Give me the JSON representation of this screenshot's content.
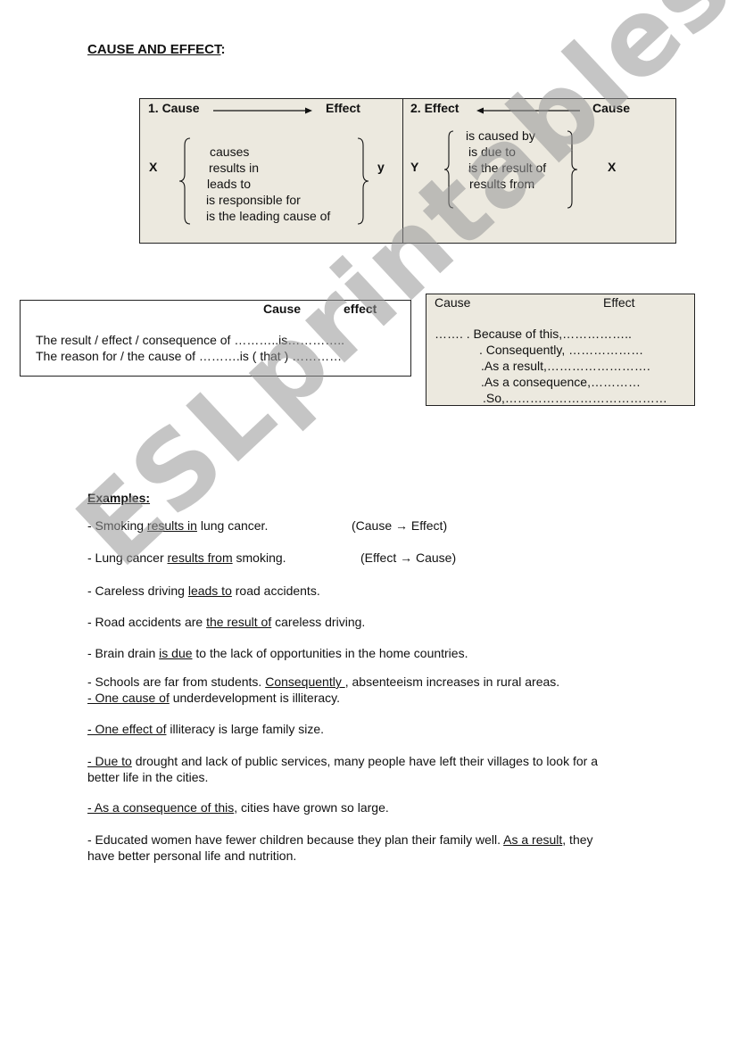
{
  "title": "CAUSE AND EFFECT",
  "title_colon": ":",
  "diagram1": {
    "header_left": "1. Cause",
    "header_right": "Effect",
    "left_var": "X",
    "right_var": "y",
    "phrases": [
      "causes",
      "results in",
      "leads to",
      "is responsible for",
      "is the leading cause of"
    ]
  },
  "diagram2": {
    "header_left": "2. Effect",
    "header_right": "Cause",
    "left_var": "Y",
    "right_var": "X",
    "phrases": [
      "is caused by",
      "is due to",
      "is the result of",
      "results from"
    ]
  },
  "noun_box": {
    "col_cause": "Cause",
    "col_effect": "effect",
    "lines": [
      "The result / effect / consequence of ………..is…………..",
      "The reason for  /  the cause of  ……….is ( that ) …………"
    ]
  },
  "connector_box": {
    "col_cause": "Cause",
    "col_effect": "Effect",
    "lines": [
      "…….  . Because of this,……………..",
      ". Consequently, ………………",
      ".As a result,…………………….",
      ".As a consequence,…………",
      ".So,…………………………………"
    ]
  },
  "examples": {
    "heading": "Examples:",
    "items": [
      {
        "pre": "- Smoking ",
        "u": "results in",
        "post": " lung cancer.",
        "note": "(Cause → Effect)"
      },
      {
        "pre": "- Lung cancer ",
        "u": "results from",
        "post": " smoking.",
        "note": "(Effect → Cause)"
      },
      {
        "pre": "- Careless driving ",
        "u": "leads to",
        "post": " road accidents."
      },
      {
        "pre": "- Road accidents are ",
        "u": "the result of",
        "post": " careless driving."
      },
      {
        "pre": "- Brain drain ",
        "u": "is due",
        "post": " to the lack of opportunities in the home countries."
      },
      {
        "pre": "- Schools are far from students. ",
        "u": "Consequently ",
        "post": ", absenteeism increases in rural areas."
      },
      {
        "pre": "",
        "u": "- One cause of",
        "post": " underdevelopment is illiteracy."
      },
      {
        "pre": "",
        "u": "- One effect of",
        "post": " illiteracy is large family size."
      },
      {
        "pre": "",
        "u": "- Due to",
        "post": " drought and lack of public services, many people have left their villages to  look for a",
        "line2": "better life in the cities."
      },
      {
        "pre": "",
        "u": "- As a consequence of this",
        "post": ", cities have grown so large."
      },
      {
        "pre": "- Educated women have fewer children because they plan their family well. ",
        "u": "As a result",
        "post": ", they",
        "line2": "have better personal life and nutrition."
      }
    ]
  },
  "watermark": "ESLprintables.com"
}
